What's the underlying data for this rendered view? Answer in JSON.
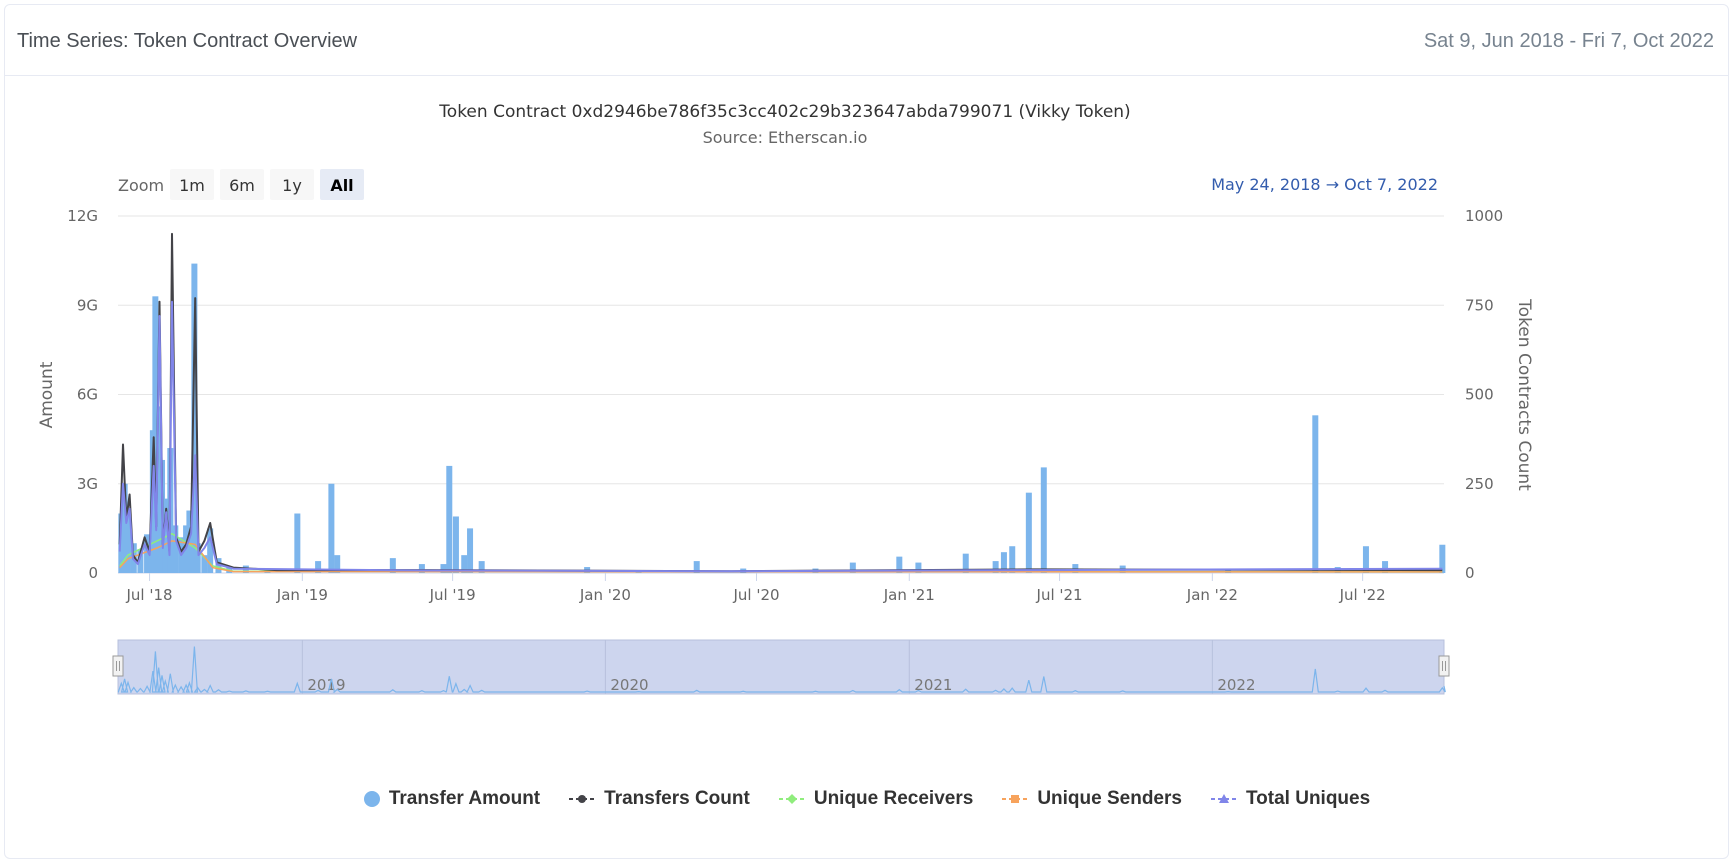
{
  "header": {
    "title": "Time Series: Token Contract Overview",
    "range": "Sat 9, Jun 2018 - Fri 7, Oct 2022"
  },
  "toolbar": {
    "zoom_label": "Zoom",
    "zoom_buttons": [
      "1m",
      "6m",
      "1y",
      "All"
    ],
    "selected_zoom": "All",
    "range_from": "May 24, 2018",
    "range_arrow": "→",
    "range_to": "Oct 7, 2022"
  },
  "colors": {
    "transfer_amount": "#7cb5ec",
    "transfers_count": "#434348",
    "unique_receivers": "#90ed7d",
    "unique_senders": "#f7a35c",
    "total_uniques": "#8085e9",
    "navigator_fill": "#cdd5ee",
    "grid": "#e6e6e6"
  },
  "chart_data": {
    "type": "bar",
    "title": "Token Contract 0xd2946be786f35c3cc402c29b323647abda799071 (Vikky Token)",
    "subtitle": "Source: Etherscan.io",
    "x_range": [
      "2018-05-24",
      "2022-10-07"
    ],
    "x_ticks": [
      {
        "date": "2018-07-01",
        "label": "Jul '18"
      },
      {
        "date": "2019-01-01",
        "label": "Jan '19"
      },
      {
        "date": "2019-07-01",
        "label": "Jul '19"
      },
      {
        "date": "2020-01-01",
        "label": "Jan '20"
      },
      {
        "date": "2020-07-01",
        "label": "Jul '20"
      },
      {
        "date": "2021-01-01",
        "label": "Jan '21"
      },
      {
        "date": "2021-07-01",
        "label": "Jul '21"
      },
      {
        "date": "2022-01-01",
        "label": "Jan '22"
      },
      {
        "date": "2022-07-01",
        "label": "Jul '22"
      }
    ],
    "y_left": {
      "label": "Amount",
      "min": 0,
      "max": 12000000000,
      "ticks": [
        0,
        3000000000,
        6000000000,
        9000000000,
        12000000000
      ],
      "tick_labels": [
        "0",
        "3G",
        "6G",
        "9G",
        "12G"
      ]
    },
    "y_right": {
      "label": "Token Contracts Count",
      "min": 0,
      "max": 1000,
      "ticks": [
        0,
        250,
        500,
        750,
        1000
      ],
      "tick_labels": [
        "0",
        "250",
        "500",
        "750",
        "1000"
      ]
    },
    "legend_position": "bottom",
    "grid": true,
    "series": [
      {
        "name": "Transfer Amount",
        "type": "column",
        "axis": "left",
        "points": [
          [
            "2018-05-28",
            2000000000.0
          ],
          [
            "2018-06-01",
            3000000000.0
          ],
          [
            "2018-06-05",
            2200000000.0
          ],
          [
            "2018-06-12",
            1000000000.0
          ],
          [
            "2018-06-20",
            800000000.0
          ],
          [
            "2018-06-28",
            1300000000.0
          ],
          [
            "2018-07-05",
            4800000000.0
          ],
          [
            "2018-07-08",
            9300000000.0
          ],
          [
            "2018-07-12",
            5600000000.0
          ],
          [
            "2018-07-16",
            3800000000.0
          ],
          [
            "2018-07-20",
            2500000000.0
          ],
          [
            "2018-07-26",
            4200000000.0
          ],
          [
            "2018-08-01",
            1600000000.0
          ],
          [
            "2018-08-08",
            1200000000.0
          ],
          [
            "2018-08-14",
            1600000000.0
          ],
          [
            "2018-08-18",
            2100000000.0
          ],
          [
            "2018-08-24",
            10400000000.0
          ],
          [
            "2018-08-28",
            1000000000.0
          ],
          [
            "2018-09-05",
            600000000.0
          ],
          [
            "2018-09-12",
            1500000000.0
          ],
          [
            "2018-09-22",
            500000000.0
          ],
          [
            "2018-10-05",
            200000000.0
          ],
          [
            "2018-10-25",
            250000000.0
          ],
          [
            "2018-11-20",
            150000000.0
          ],
          [
            "2018-12-26",
            2000000000.0
          ],
          [
            "2019-01-20",
            400000000.0
          ],
          [
            "2019-02-05",
            3000000000.0
          ],
          [
            "2019-02-12",
            600000000.0
          ],
          [
            "2019-04-20",
            500000000.0
          ],
          [
            "2019-05-25",
            300000000.0
          ],
          [
            "2019-06-20",
            300000000.0
          ],
          [
            "2019-06-27",
            3600000000.0
          ],
          [
            "2019-07-05",
            1900000000.0
          ],
          [
            "2019-07-15",
            600000000.0
          ],
          [
            "2019-07-22",
            1500000000.0
          ],
          [
            "2019-08-05",
            400000000.0
          ],
          [
            "2019-12-10",
            200000000.0
          ],
          [
            "2020-02-10",
            100000000.0
          ],
          [
            "2020-04-20",
            400000000.0
          ],
          [
            "2020-06-15",
            150000000.0
          ],
          [
            "2020-09-10",
            150000000.0
          ],
          [
            "2020-10-25",
            350000000.0
          ],
          [
            "2020-12-20",
            550000000.0
          ],
          [
            "2021-01-12",
            350000000.0
          ],
          [
            "2021-03-10",
            650000000.0
          ],
          [
            "2021-04-15",
            400000000.0
          ],
          [
            "2021-04-25",
            700000000.0
          ],
          [
            "2021-05-05",
            900000000.0
          ],
          [
            "2021-05-25",
            2700000000.0
          ],
          [
            "2021-06-12",
            3550000000.0
          ],
          [
            "2021-07-20",
            300000000.0
          ],
          [
            "2021-09-15",
            250000000.0
          ],
          [
            "2022-01-20",
            100000000.0
          ],
          [
            "2022-05-05",
            5300000000.0
          ],
          [
            "2022-06-01",
            200000000.0
          ],
          [
            "2022-07-05",
            900000000.0
          ],
          [
            "2022-07-28",
            400000000.0
          ],
          [
            "2022-10-05",
            950000000.0
          ]
        ]
      },
      {
        "name": "Transfers Count",
        "type": "line",
        "axis": "right",
        "points": [
          [
            "2018-05-26",
            80
          ],
          [
            "2018-05-30",
            360
          ],
          [
            "2018-06-03",
            150
          ],
          [
            "2018-06-07",
            220
          ],
          [
            "2018-06-11",
            50
          ],
          [
            "2018-06-17",
            30
          ],
          [
            "2018-06-25",
            100
          ],
          [
            "2018-07-01",
            60
          ],
          [
            "2018-07-06",
            380
          ],
          [
            "2018-07-09",
            130
          ],
          [
            "2018-07-13",
            760
          ],
          [
            "2018-07-17",
            80
          ],
          [
            "2018-07-21",
            180
          ],
          [
            "2018-07-25",
            60
          ],
          [
            "2018-07-28",
            950
          ],
          [
            "2018-08-02",
            100
          ],
          [
            "2018-08-08",
            60
          ],
          [
            "2018-08-14",
            80
          ],
          [
            "2018-08-20",
            130
          ],
          [
            "2018-08-25",
            770
          ],
          [
            "2018-08-29",
            60
          ],
          [
            "2018-09-05",
            90
          ],
          [
            "2018-09-12",
            140
          ],
          [
            "2018-09-20",
            30
          ],
          [
            "2018-10-10",
            15
          ],
          [
            "2018-12-01",
            8
          ],
          [
            "2019-06-01",
            8
          ],
          [
            "2020-06-01",
            5
          ],
          [
            "2021-06-01",
            10
          ],
          [
            "2022-10-05",
            8
          ]
        ]
      },
      {
        "name": "Unique Receivers",
        "type": "line",
        "axis": "right",
        "points": [
          [
            "2018-05-26",
            20
          ],
          [
            "2018-06-05",
            50
          ],
          [
            "2018-07-10",
            90
          ],
          [
            "2018-07-28",
            110
          ],
          [
            "2018-08-25",
            70
          ],
          [
            "2018-09-15",
            20
          ],
          [
            "2018-10-10",
            5
          ],
          [
            "2022-10-05",
            3
          ]
        ]
      },
      {
        "name": "Unique Senders",
        "type": "line",
        "axis": "right",
        "points": [
          [
            "2018-05-26",
            15
          ],
          [
            "2018-06-05",
            40
          ],
          [
            "2018-07-10",
            70
          ],
          [
            "2018-07-28",
            90
          ],
          [
            "2018-08-25",
            80
          ],
          [
            "2018-09-15",
            15
          ],
          [
            "2018-10-10",
            4
          ],
          [
            "2022-10-05",
            3
          ]
        ]
      },
      {
        "name": "Total Uniques",
        "type": "line",
        "axis": "right",
        "points": [
          [
            "2018-05-26",
            60
          ],
          [
            "2018-05-30",
            250
          ],
          [
            "2018-06-03",
            140
          ],
          [
            "2018-06-07",
            180
          ],
          [
            "2018-06-11",
            40
          ],
          [
            "2018-06-17",
            25
          ],
          [
            "2018-06-25",
            80
          ],
          [
            "2018-07-01",
            50
          ],
          [
            "2018-07-06",
            300
          ],
          [
            "2018-07-09",
            120
          ],
          [
            "2018-07-13",
            720
          ],
          [
            "2018-07-17",
            70
          ],
          [
            "2018-07-21",
            170
          ],
          [
            "2018-07-25",
            50
          ],
          [
            "2018-07-28",
            760
          ],
          [
            "2018-08-02",
            90
          ],
          [
            "2018-08-08",
            50
          ],
          [
            "2018-08-14",
            70
          ],
          [
            "2018-08-20",
            110
          ],
          [
            "2018-08-25",
            330
          ],
          [
            "2018-08-29",
            50
          ],
          [
            "2018-09-05",
            70
          ],
          [
            "2018-09-12",
            100
          ],
          [
            "2018-09-20",
            25
          ],
          [
            "2018-10-10",
            12
          ],
          [
            "2019-06-01",
            7
          ],
          [
            "2020-06-01",
            5
          ],
          [
            "2021-06-01",
            8
          ],
          [
            "2022-10-05",
            12
          ]
        ]
      }
    ],
    "navigator": {
      "year_labels": [
        {
          "date": "2019-01-01",
          "label": "2019"
        },
        {
          "date": "2020-01-01",
          "label": "2020"
        },
        {
          "date": "2021-01-01",
          "label": "2021"
        },
        {
          "date": "2022-01-01",
          "label": "2022"
        }
      ]
    }
  },
  "legend": {
    "items": [
      {
        "label": "Transfer Amount",
        "key": "transfer_amount",
        "symbol": "circle"
      },
      {
        "label": "Transfers Count",
        "key": "transfers_count",
        "symbol": "line-circle"
      },
      {
        "label": "Unique Receivers",
        "key": "unique_receivers",
        "symbol": "line-diamond"
      },
      {
        "label": "Unique Senders",
        "key": "unique_senders",
        "symbol": "line-square"
      },
      {
        "label": "Total Uniques",
        "key": "total_uniques",
        "symbol": "line-triangle"
      }
    ]
  }
}
